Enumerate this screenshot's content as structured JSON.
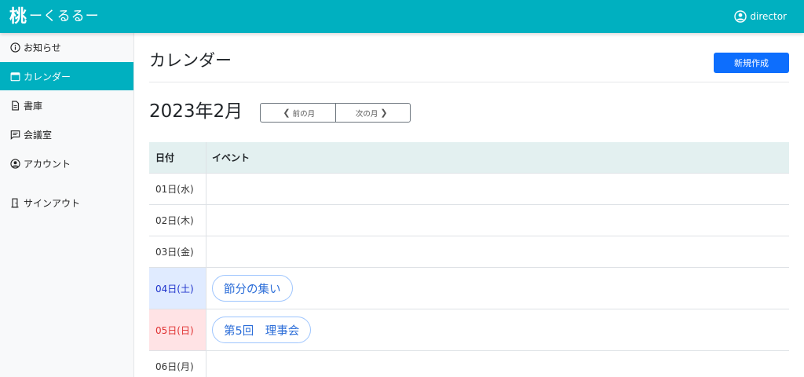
{
  "app": {
    "logo_kanji": "桃",
    "logo_text": "ーくるるー",
    "user_name": "director"
  },
  "sidebar": {
    "items": [
      {
        "label": "お知らせ",
        "icon": "info-icon",
        "active": false
      },
      {
        "label": "カレンダー",
        "icon": "calendar-icon",
        "active": true
      },
      {
        "label": "書庫",
        "icon": "document-icon",
        "active": false
      },
      {
        "label": "会議室",
        "icon": "chat-icon",
        "active": false
      },
      {
        "label": "アカウント",
        "icon": "user-circle-icon",
        "active": false
      },
      {
        "label": "サインアウト",
        "icon": "door-icon",
        "active": false
      }
    ]
  },
  "page": {
    "title": "カレンダー",
    "new_button": "新規作成"
  },
  "calendar": {
    "month_title": "2023年2月",
    "prev_label": "前の月",
    "next_label": "次の月",
    "headers": {
      "date": "日付",
      "event": "イベント"
    },
    "rows": [
      {
        "date": "01日(水)",
        "event": ""
      },
      {
        "date": "02日(木)",
        "event": ""
      },
      {
        "date": "03日(金)",
        "event": ""
      },
      {
        "date": "04日(土)",
        "event": "節分の集い"
      },
      {
        "date": "05日(日)",
        "event": "第5回　理事会"
      },
      {
        "date": "06日(月)",
        "event": ""
      }
    ]
  },
  "colors": {
    "brand": "#00b0c0",
    "primary": "#0d6efd",
    "saturday_bg": "#e0ebff",
    "sunday_bg": "#ffe3e5"
  }
}
